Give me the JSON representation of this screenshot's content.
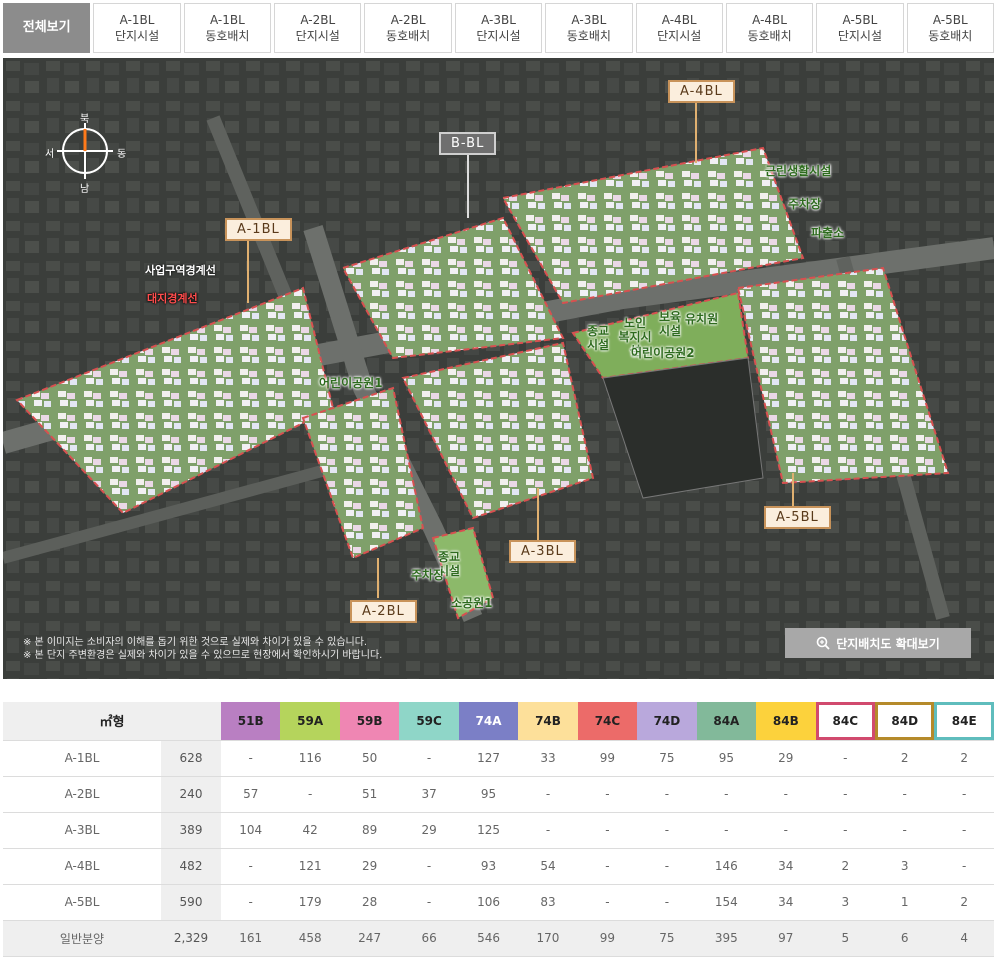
{
  "tabs": [
    {
      "line1": "전체보기",
      "line2": "",
      "active": true
    },
    {
      "line1": "A-1BL",
      "line2": "단지시설"
    },
    {
      "line1": "A-1BL",
      "line2": "동호배치"
    },
    {
      "line1": "A-2BL",
      "line2": "단지시설"
    },
    {
      "line1": "A-2BL",
      "line2": "동호배치"
    },
    {
      "line1": "A-3BL",
      "line2": "단지시설"
    },
    {
      "line1": "A-3BL",
      "line2": "동호배치"
    },
    {
      "line1": "A-4BL",
      "line2": "단지시설"
    },
    {
      "line1": "A-4BL",
      "line2": "동호배치"
    },
    {
      "line1": "A-5BL",
      "line2": "단지시설"
    },
    {
      "line1": "A-5BL",
      "line2": "동호배치"
    }
  ],
  "map": {
    "compass": {
      "north": "북",
      "south": "남",
      "west": "서",
      "east": "동"
    },
    "blocks": {
      "a4": "A-4BL",
      "b": "B-BL",
      "a1": "A-1BL",
      "a3": "A-3BL",
      "a2": "A-2BL",
      "a5": "A-5BL"
    },
    "labels": {
      "project_line": "사업구역경계선",
      "site_line": "대지경계선",
      "retail": "근린생활시설",
      "parking1": "주차장",
      "police": "파출소",
      "religion": "종교\n시설",
      "senior": "노인\n복지시설",
      "childcare": "보육\n시설",
      "kindergarten": "유치원",
      "park2": "어린이공원2",
      "park1": "어린이공원1",
      "religion2": "종교\n시설",
      "parking2": "주차장",
      "small_park": "소공원1"
    },
    "notes": [
      "※ 본 이미지는 소비자의 이해를 돕기 위한 것으로 실제와 차이가 있을 수 있습니다.",
      "※ 본 단지 주변환경은 실제와 차이가 있을 수 있으므로 현장에서 확인하시기 바랍니다."
    ],
    "zoom_button": "단지배치도 확대보기"
  },
  "table": {
    "header_type": "㎡형",
    "columns": [
      {
        "label": "51B",
        "color": "#b97fc2",
        "text": "#222"
      },
      {
        "label": "59A",
        "color": "#b5d45c",
        "text": "#222"
      },
      {
        "label": "59B",
        "color": "#ef86b3",
        "text": "#222"
      },
      {
        "label": "59C",
        "color": "#8fd6c8",
        "text": "#222"
      },
      {
        "label": "74A",
        "color": "#7b7fc6",
        "text": "#fff"
      },
      {
        "label": "74B",
        "color": "#fde09a",
        "text": "#222"
      },
      {
        "label": "74C",
        "color": "#ec6b69",
        "text": "#222"
      },
      {
        "label": "74D",
        "color": "#b9a8dc",
        "text": "#222"
      },
      {
        "label": "84A",
        "color": "#82b99a",
        "text": "#222"
      },
      {
        "label": "84B",
        "color": "#fcd23c",
        "text": "#222"
      },
      {
        "label": "84C",
        "color": "#ffffff",
        "border": "#d14a6e",
        "text": "#222"
      },
      {
        "label": "84D",
        "color": "#ffffff",
        "border": "#b58a2a",
        "text": "#222"
      },
      {
        "label": "84E",
        "color": "#ffffff",
        "border": "#5fbdbd",
        "text": "#222"
      }
    ],
    "rows": [
      {
        "block": "A-1BL",
        "total": "628",
        "values": [
          "-",
          "116",
          "50",
          "-",
          "127",
          "33",
          "99",
          "75",
          "95",
          "29",
          "-",
          "2",
          "2"
        ]
      },
      {
        "block": "A-2BL",
        "total": "240",
        "values": [
          "57",
          "-",
          "51",
          "37",
          "95",
          "-",
          "-",
          "-",
          "-",
          "-",
          "-",
          "-",
          "-"
        ]
      },
      {
        "block": "A-3BL",
        "total": "389",
        "values": [
          "104",
          "42",
          "89",
          "29",
          "125",
          "-",
          "-",
          "-",
          "-",
          "-",
          "-",
          "-",
          "-"
        ]
      },
      {
        "block": "A-4BL",
        "total": "482",
        "values": [
          "-",
          "121",
          "29",
          "-",
          "93",
          "54",
          "-",
          "-",
          "146",
          "34",
          "2",
          "3",
          "-"
        ]
      },
      {
        "block": "A-5BL",
        "total": "590",
        "values": [
          "-",
          "179",
          "28",
          "-",
          "106",
          "83",
          "-",
          "-",
          "154",
          "34",
          "3",
          "1",
          "2"
        ]
      },
      {
        "block": "일반분양",
        "total": "2,329",
        "values": [
          "161",
          "458",
          "247",
          "66",
          "546",
          "170",
          "99",
          "75",
          "395",
          "97",
          "5",
          "6",
          "4"
        ]
      }
    ]
  }
}
